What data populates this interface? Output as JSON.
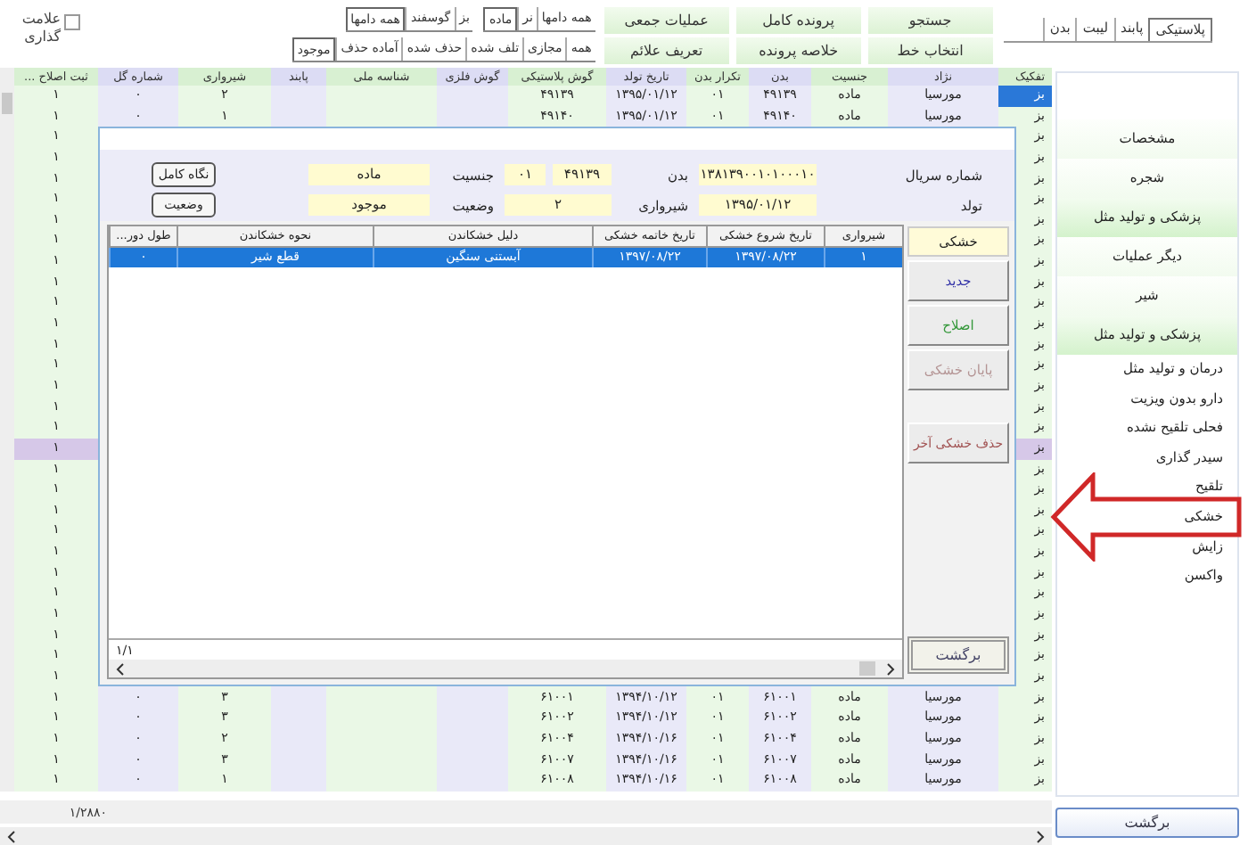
{
  "mark_toggle": {
    "label": "علامت گذاری",
    "checked": false
  },
  "filter_rows": [
    {
      "groups": [
        {
          "tabs": [
            {
              "label": "همه دامها",
              "selected": false
            },
            {
              "label": "نر",
              "selected": false
            },
            {
              "label": "ماده",
              "selected": true
            }
          ]
        },
        {
          "tabs": [
            {
              "label": "بز",
              "selected": false
            },
            {
              "label": "گوسفند",
              "selected": false
            },
            {
              "label": "همه دامها",
              "selected": true
            }
          ]
        }
      ]
    },
    {
      "groups": [
        {
          "tabs": [
            {
              "label": "همه",
              "selected": false
            },
            {
              "label": "مجازی",
              "selected": false
            },
            {
              "label": "تلف شده",
              "selected": false
            },
            {
              "label": "حذف شده",
              "selected": false
            },
            {
              "label": "آماده حذف",
              "selected": false
            },
            {
              "label": "موجود",
              "selected": true
            }
          ]
        }
      ]
    }
  ],
  "action_buttons": [
    "جستجو",
    "پرونده کامل",
    "عملیات جمعی",
    "انتخاب خط",
    "خلاصه پرونده",
    "تعریف علائم"
  ],
  "view_tabs": [
    {
      "label": "پلاستیکی",
      "selected": true
    },
    {
      "label": "پابند",
      "selected": false
    },
    {
      "label": "لیبت",
      "selected": false
    },
    {
      "label": "بدن",
      "selected": false
    }
  ],
  "table": {
    "columns": [
      "تفکیک",
      "نژاد",
      "جنسیت",
      "بدن",
      "تکرار بدن",
      "تاریخ تولد",
      "گوش پلاستیکی",
      "گوش فلزی",
      "شناسه ملی",
      "پابند",
      "شیرواری",
      "شماره گل",
      "ثبت اصلاح ..."
    ],
    "rows": [
      {
        "split": "بز",
        "breed": "مورسیا",
        "sex": "ماده",
        "body": "۴۹۱۳۹",
        "body_repeat": "۰۱",
        "birth_date": "۱۳۹۵/۰۱/۱۲",
        "plastic_tag": "۴۹۱۳۹",
        "milking": "۲",
        "flock_no": "۰",
        "correction": "۱",
        "selected": true,
        "marked": false
      },
      {
        "split": "بز",
        "breed": "مورسیا",
        "sex": "ماده",
        "body": "۴۹۱۴۰",
        "body_repeat": "۰۱",
        "birth_date": "۱۳۹۵/۰۱/۱۲",
        "plastic_tag": "۴۹۱۴۰",
        "milking": "۱",
        "flock_no": "۰",
        "correction": "۱",
        "selected": false,
        "marked": false
      },
      {
        "split": "بز",
        "correction": "۱",
        "selected": false,
        "marked": false
      },
      {
        "split": "بز",
        "correction": "۱",
        "selected": false,
        "marked": false
      },
      {
        "split": "بز",
        "correction": "۱",
        "selected": false,
        "marked": false
      },
      {
        "split": "بز",
        "correction": "۱",
        "selected": false,
        "marked": false
      },
      {
        "split": "بز",
        "correction": "۱",
        "selected": false,
        "marked": false
      },
      {
        "split": "بز",
        "correction": "۱",
        "selected": false,
        "marked": false
      },
      {
        "split": "بز",
        "correction": "۱",
        "selected": false,
        "marked": false
      },
      {
        "split": "بز",
        "correction": "۱",
        "selected": false,
        "marked": false
      },
      {
        "split": "بز",
        "correction": "۱",
        "selected": false,
        "marked": false
      },
      {
        "split": "بز",
        "correction": "۱",
        "selected": false,
        "marked": false
      },
      {
        "split": "بز",
        "correction": "۱",
        "selected": false,
        "marked": false
      },
      {
        "split": "بز",
        "correction": "۱",
        "selected": false,
        "marked": false
      },
      {
        "split": "بز",
        "correction": "۱",
        "selected": false,
        "marked": false
      },
      {
        "split": "بز",
        "correction": "۱",
        "selected": false,
        "marked": false
      },
      {
        "split": "بز",
        "correction": "۱",
        "selected": false,
        "marked": false
      },
      {
        "split": "بز",
        "correction": "۱",
        "selected": false,
        "marked": true
      },
      {
        "split": "بز",
        "correction": "۱",
        "selected": false,
        "marked": false
      },
      {
        "split": "بز",
        "correction": "۱",
        "selected": false,
        "marked": false
      },
      {
        "split": "بز",
        "correction": "۱",
        "selected": false,
        "marked": false
      },
      {
        "split": "بز",
        "correction": "۱",
        "selected": false,
        "marked": false
      },
      {
        "split": "بز",
        "correction": "۱",
        "selected": false,
        "marked": false
      },
      {
        "split": "بز",
        "correction": "۱",
        "selected": false,
        "marked": false
      },
      {
        "split": "بز",
        "correction": "۱",
        "selected": false,
        "marked": false
      },
      {
        "split": "بز",
        "correction": "۱",
        "selected": false,
        "marked": false
      },
      {
        "split": "بز",
        "correction": "۱",
        "selected": false,
        "marked": false
      },
      {
        "split": "بز",
        "correction": "۱",
        "selected": false,
        "marked": false
      },
      {
        "split": "بز",
        "correction": "۱",
        "selected": false,
        "marked": false
      },
      {
        "split": "بز",
        "breed": "مورسیا",
        "sex": "ماده",
        "body": "۶۱۰۰۱",
        "body_repeat": "۰۱",
        "birth_date": "۱۳۹۴/۱۰/۱۲",
        "plastic_tag": "۶۱۰۰۱",
        "milking": "۳",
        "flock_no": "۰",
        "correction": "۱",
        "selected": false,
        "marked": false
      },
      {
        "split": "بز",
        "breed": "مورسیا",
        "sex": "ماده",
        "body": "۶۱۰۰۲",
        "body_repeat": "۰۱",
        "birth_date": "۱۳۹۴/۱۰/۱۲",
        "plastic_tag": "۶۱۰۰۲",
        "milking": "۳",
        "flock_no": "۰",
        "correction": "۱",
        "selected": false,
        "marked": false
      },
      {
        "split": "بز",
        "breed": "مورسیا",
        "sex": "ماده",
        "body": "۶۱۰۰۴",
        "body_repeat": "۰۱",
        "birth_date": "۱۳۹۴/۱۰/۱۶",
        "plastic_tag": "۶۱۰۰۴",
        "milking": "۲",
        "flock_no": "۰",
        "correction": "۱",
        "selected": false,
        "marked": false
      },
      {
        "split": "بز",
        "breed": "مورسیا",
        "sex": "ماده",
        "body": "۶۱۰۰۷",
        "body_repeat": "۰۱",
        "birth_date": "۱۳۹۴/۱۰/۱۶",
        "plastic_tag": "۶۱۰۰۷",
        "milking": "۳",
        "flock_no": "۰",
        "correction": "۱",
        "selected": false,
        "marked": false
      },
      {
        "split": "بز",
        "breed": "مورسیا",
        "sex": "ماده",
        "body": "۶۱۰۰۸",
        "body_repeat": "۰۱",
        "birth_date": "۱۳۹۴/۱۰/۱۶",
        "plastic_tag": "۶۱۰۰۸",
        "milking": "۱",
        "flock_no": "۰",
        "correction": "۱",
        "selected": false,
        "marked": false
      }
    ],
    "record_count": "۱/۲۸۸۰"
  },
  "dialog": {
    "info_rows": [
      [
        {
          "kind": "label",
          "text": "شماره سریال"
        },
        {
          "kind": "field",
          "text": "۱۳۸۱۳۹۰۰۱۰۱۰۰۰۱۰"
        },
        {
          "kind": "label",
          "text": "بدن"
        },
        {
          "kind": "field",
          "text": "۴۹۱۳۹"
        },
        {
          "kind": "field",
          "text": "۰۱"
        },
        {
          "kind": "label",
          "text": "جنسیت"
        },
        {
          "kind": "field",
          "text": "ماده"
        },
        {
          "kind": "button",
          "text": "نگاه کامل"
        }
      ],
      [
        {
          "kind": "label",
          "text": "تولد"
        },
        {
          "kind": "field",
          "text": "۱۳۹۵/۰۱/۱۲"
        },
        {
          "kind": "label",
          "text": "شیرواری"
        },
        {
          "kind": "field",
          "text": "۲"
        },
        {
          "kind": "label",
          "text": "وضعیت"
        },
        {
          "kind": "field",
          "text": "موجود"
        },
        {
          "kind": "button",
          "text": "وضعیت"
        }
      ]
    ],
    "side_tab": "خشکی",
    "actions": [
      {
        "label": "جدید",
        "color": "#3434a8"
      },
      {
        "label": "اصلاح",
        "color": "#34983a"
      },
      {
        "label": "پایان خشکی",
        "color": "#b49494"
      },
      {
        "label": "حذف خشکی آخر",
        "color": "#a05050"
      }
    ],
    "back_button": "برگشت",
    "grid": {
      "columns": [
        "شیرواری",
        "تاریخ شروع خشکی",
        "تاریخ خاتمه خشکی",
        "دلیل خشکاندن",
        "نحوه خشکاندن",
        "طول دور..."
      ],
      "rows": [
        {
          "milking": "۱",
          "start": "۱۳۹۷/۰۸/۲۲",
          "end": "۱۳۹۷/۰۸/۲۲",
          "reason": "آبستنی سنگین",
          "method": "قطع شیر",
          "length": "۰",
          "selected": true
        }
      ],
      "position": "۱/۱"
    }
  },
  "menu": [
    {
      "label": "مشخصات",
      "selected": false
    },
    {
      "label": "شجره",
      "selected": false
    },
    {
      "label": "پزشکی و تولید مثل",
      "selected": true
    },
    {
      "label": "دیگر عملیات",
      "selected": false
    },
    {
      "label": "شیر",
      "selected": false
    },
    {
      "label": "پزشکی و تولید مثل",
      "selected": true,
      "children": [
        {
          "label": "درمان و تولید مثل",
          "selected": false
        },
        {
          "label": "دارو بدون ویزیت",
          "selected": false
        },
        {
          "label": "فحلی تلقیح نشده",
          "selected": false
        },
        {
          "label": "سیدر گذاری",
          "selected": false
        },
        {
          "label": "تلقیح",
          "selected": false
        },
        {
          "label": "خشکی",
          "selected": false
        },
        {
          "label": "زایش",
          "selected": false
        },
        {
          "label": "واکسن",
          "selected": false
        }
      ]
    }
  ],
  "back_button": "برگشت"
}
